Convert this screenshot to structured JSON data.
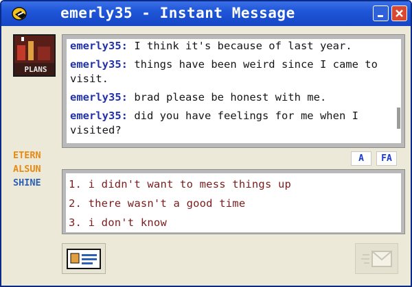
{
  "window": {
    "title": "emerly35 - Instant Message",
    "buddy_icon_text": "PLANS"
  },
  "conversation": [
    {
      "sender": "emerly35",
      "text": "I think it's because of last year."
    },
    {
      "sender": "emerly35",
      "text": "things have been weird since I came to visit."
    },
    {
      "sender": "emerly35",
      "text": "brad please be honest with me."
    },
    {
      "sender": "emerly35",
      "text": "did you have feelings for me when I visited?"
    }
  ],
  "ad_badge": [
    "ETERN",
    "ALSUN",
    "SHINE"
  ],
  "format_buttons": {
    "font": "A",
    "color": "FA"
  },
  "reply_options": [
    "1. i didn't want to mess things up",
    "2. there wasn't a good time",
    "3. i don't know"
  ],
  "icons": {
    "app": "aim-running-man-icon",
    "minimize": "minimize-icon",
    "close": "close-icon",
    "profile": "profile-card-icon",
    "send": "send-envelope-icon"
  },
  "colors": {
    "titlebar": "#1f56d8",
    "sender": "#2233aa",
    "reply_text": "#7a1c1c",
    "badge_orange": "#e78a14",
    "badge_blue": "#2c5fb6",
    "close_button": "#d9482f"
  }
}
